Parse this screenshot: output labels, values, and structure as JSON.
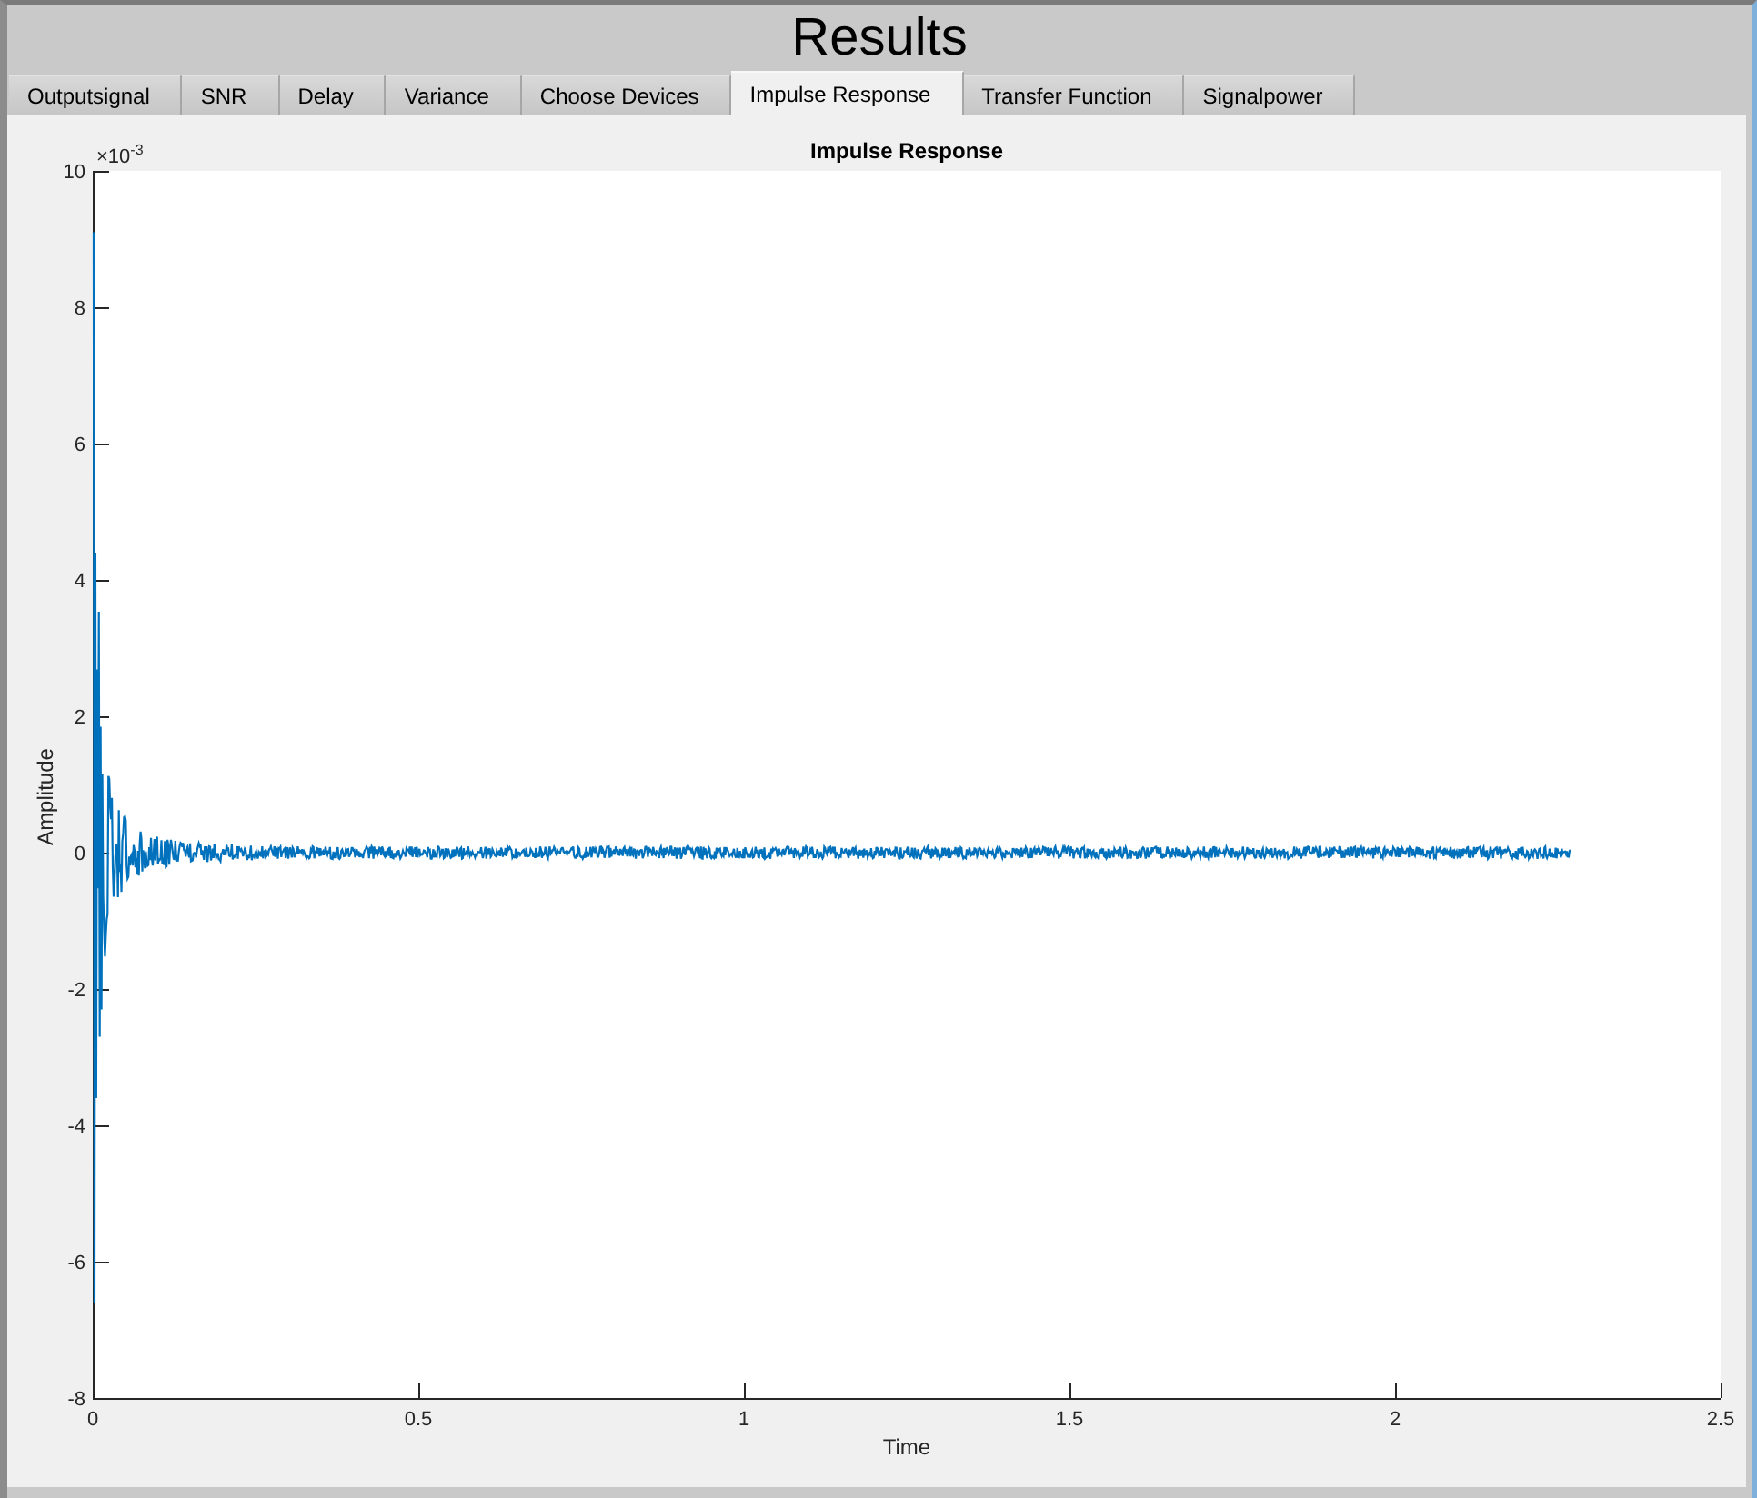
{
  "window": {
    "title": "Results"
  },
  "tabs": [
    {
      "label": "Outputsignal",
      "selected": false
    },
    {
      "label": "SNR",
      "selected": false
    },
    {
      "label": "Delay",
      "selected": false
    },
    {
      "label": "Variance",
      "selected": false
    },
    {
      "label": "Choose Devices",
      "selected": false
    },
    {
      "label": "Impulse Response",
      "selected": true
    },
    {
      "label": "Transfer Function",
      "selected": false
    },
    {
      "label": "Signalpower",
      "selected": false
    }
  ],
  "plot": {
    "title": "Impulse Response",
    "y_exponent": "×10$^{-3}$",
    "yticks": [
      "10",
      "8",
      "6",
      "4",
      "2",
      "0",
      "-2",
      "-4",
      "-6",
      "-8"
    ],
    "xticks": [
      "0",
      "0.5",
      "1",
      "1.5",
      "2",
      "2.5"
    ],
    "xlabel": "Time",
    "ylabel": "Amplitude"
  }
}
